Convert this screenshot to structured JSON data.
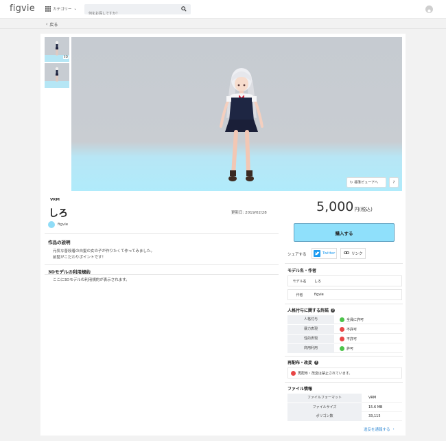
{
  "header": {
    "logo": "figvie",
    "category_label": "カテゴリー",
    "search_placeholder": "何をお探しですか？"
  },
  "nav": {
    "back_label": "戻る"
  },
  "viewer": {
    "thumb_badge": "3D",
    "standard_view_label": "標準ビューアへ",
    "help_label": "?"
  },
  "model": {
    "format": "VRM",
    "title": "しろ",
    "updated": "更新日: 2019/02/28",
    "author": "figvie"
  },
  "description": {
    "heading": "作品の説明",
    "lines": [
      "元気な普段着の白髪の女の子が作りたくて作ってみました。",
      "前髪がこだわりポイントです！"
    ]
  },
  "terms": {
    "heading": "3Dモデルの利用規約",
    "text": "ここに3Dモデルの利用規約が表示されます。"
  },
  "purchase": {
    "price": "5,000",
    "price_unit": "円(税込)",
    "buy_label": "購入する"
  },
  "share": {
    "label": "シェアする",
    "twitter": "Twitter",
    "link": "リンク"
  },
  "model_info": {
    "heading": "モデル名・作者",
    "rows": [
      {
        "k": "モデル名",
        "v": "しろ"
      },
      {
        "k": "作者",
        "v": "figvie"
      }
    ]
  },
  "permissions": {
    "heading": "人格付与に関する許諾",
    "rows": [
      {
        "k": "人格付与",
        "v": "全員に許可",
        "status": "ok"
      },
      {
        "k": "暴力表現",
        "v": "不許可",
        "status": "ng"
      },
      {
        "k": "性的表現",
        "v": "不許可",
        "status": "ng"
      },
      {
        "k": "商用利用",
        "v": "許可",
        "status": "ok"
      }
    ]
  },
  "redistribution": {
    "heading": "再配布・改変",
    "text": "再配布・改変は禁止されています。"
  },
  "file_info": {
    "heading": "ファイル情報",
    "rows": [
      {
        "k": "ファイルフォーマット",
        "v": "VRM"
      },
      {
        "k": "ファイルサイズ",
        "v": "15.6 MB"
      },
      {
        "k": "ポリゴン数",
        "v": "33,115"
      }
    ]
  },
  "report_label": "違反を通報する",
  "colors": {
    "accent": "#8fe0fb",
    "twitter": "#1d9bf0",
    "ok": "#4cc34a",
    "ng": "#e84646",
    "link": "#3c8fd6"
  }
}
